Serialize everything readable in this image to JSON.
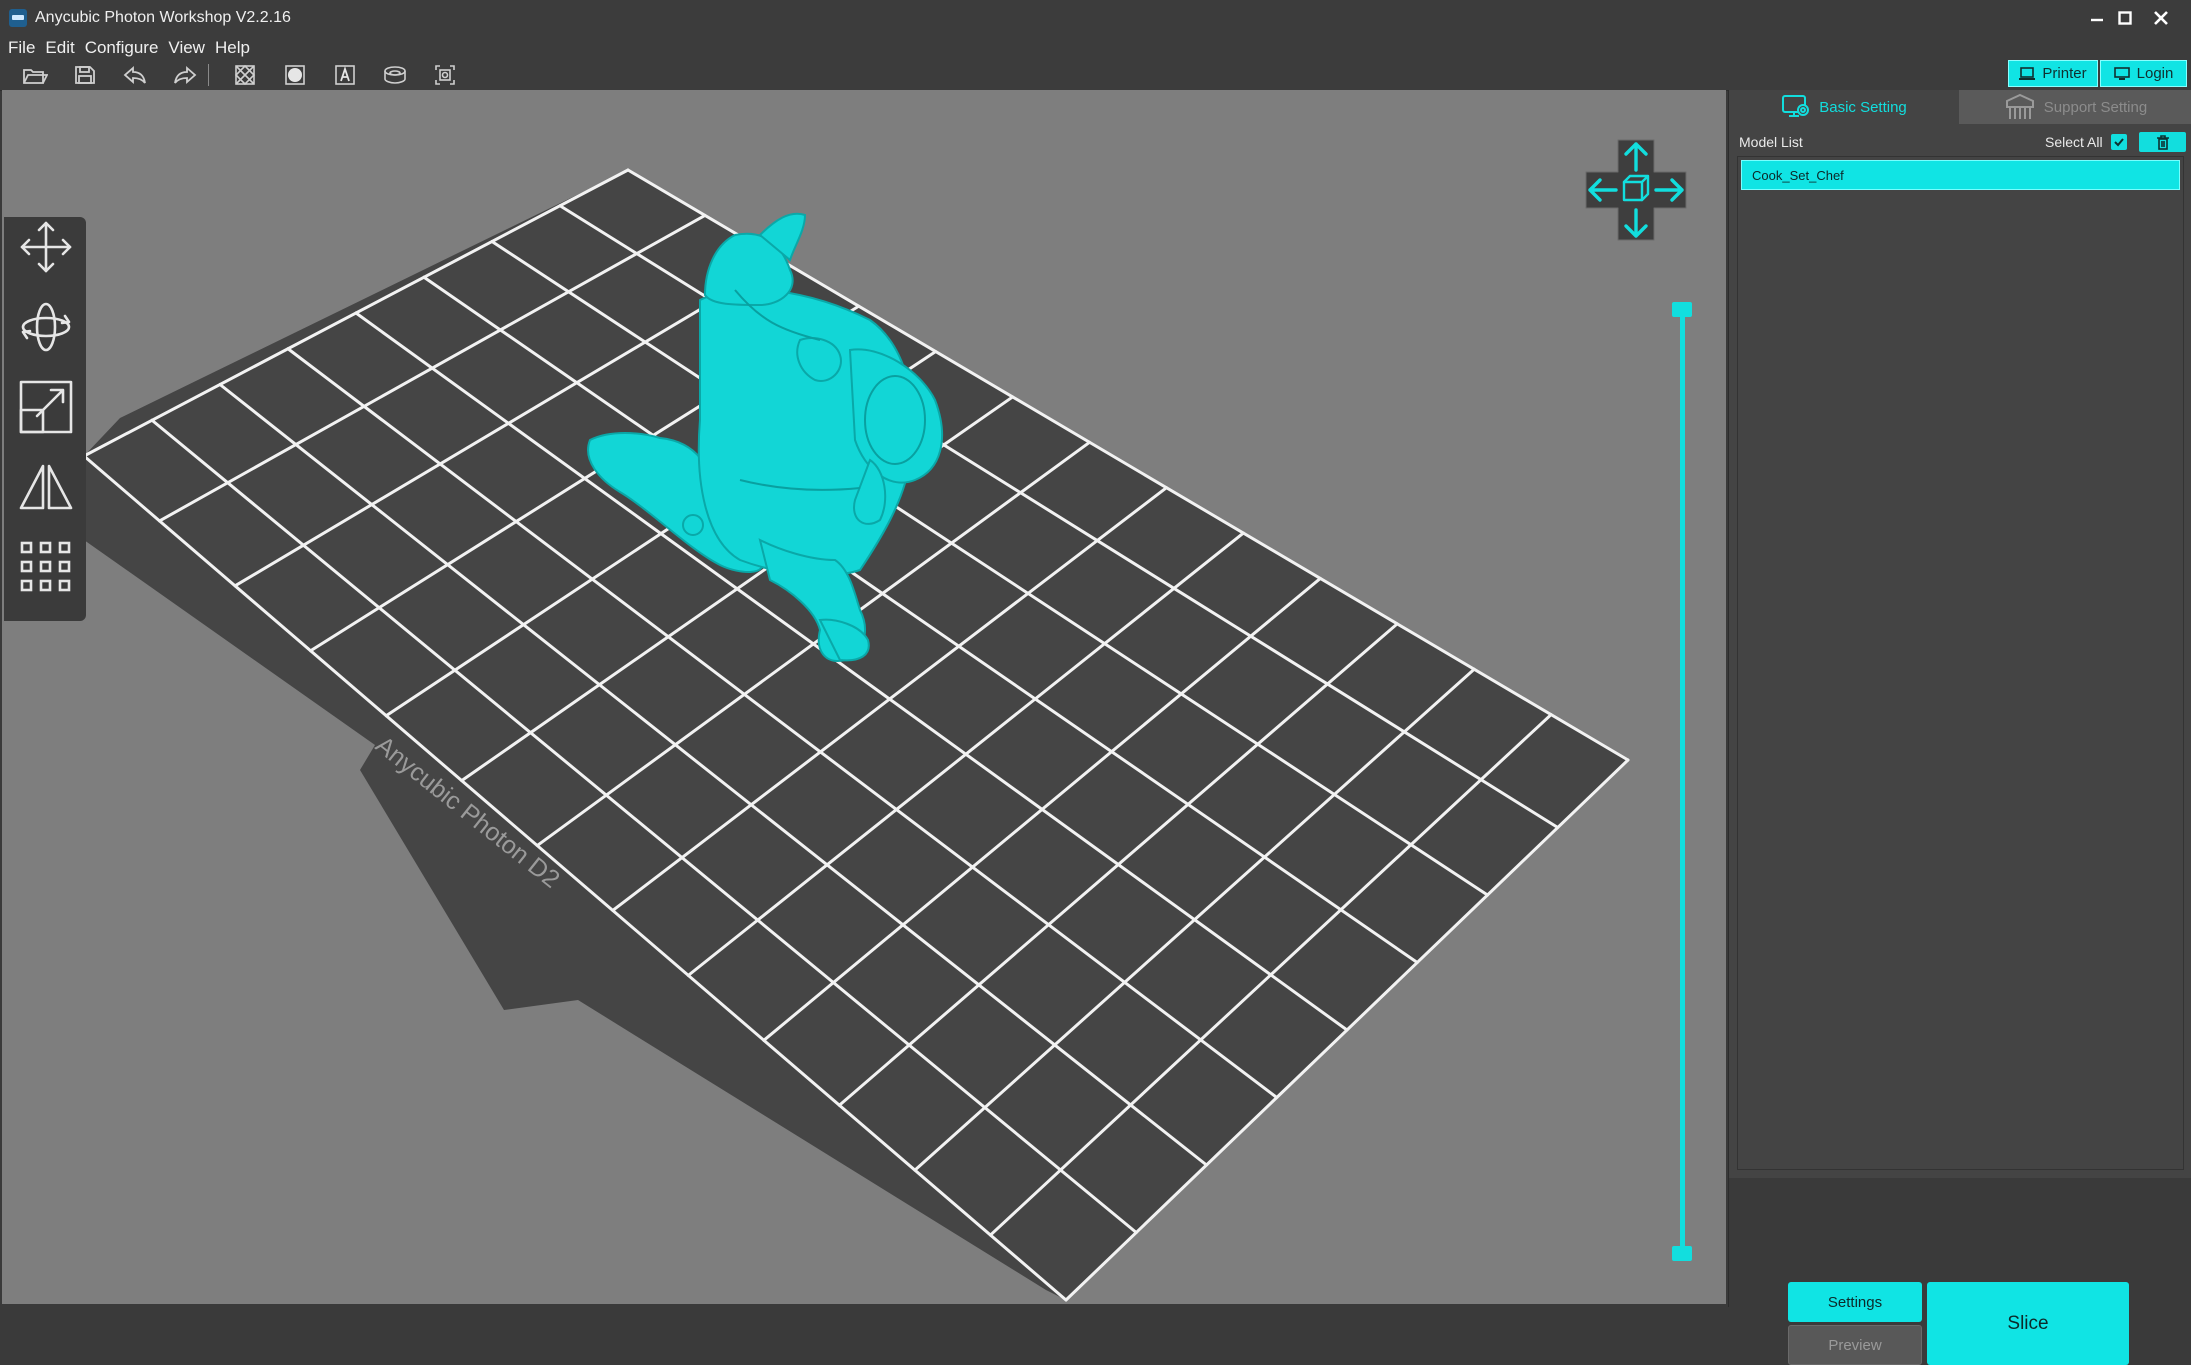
{
  "window": {
    "title": "Anycubic Photon Workshop V2.2.16"
  },
  "menu": {
    "items": [
      "File",
      "Edit",
      "Configure",
      "View",
      "Help"
    ]
  },
  "toolbar": {
    "icons": [
      "open-folder-icon",
      "save-icon",
      "undo-icon",
      "redo-icon",
      "wireframe-view-icon",
      "solid-view-icon",
      "text-icon",
      "hollow-icon",
      "punch-hole-icon"
    ]
  },
  "header_buttons": {
    "printer": "Printer",
    "login": "Login"
  },
  "left_tools": [
    "move-icon",
    "rotate-icon",
    "scale-icon",
    "mirror-icon",
    "array-icon"
  ],
  "build_plate": {
    "label": "Anycubic Photon D2"
  },
  "panel": {
    "tabs": {
      "basic": "Basic Setting",
      "support": "Support Setting"
    },
    "model_list_label": "Model List",
    "select_all_label": "Select All",
    "select_all_checked": true,
    "models": [
      "Cook_Set_Chef"
    ],
    "buttons": {
      "settings": "Settings",
      "preview": "Preview",
      "slice": "Slice"
    }
  },
  "colors": {
    "accent": "#10e4e4",
    "viewport_bg": "#7e7e7e",
    "plate": "#454545",
    "model": "#12d6d6"
  }
}
